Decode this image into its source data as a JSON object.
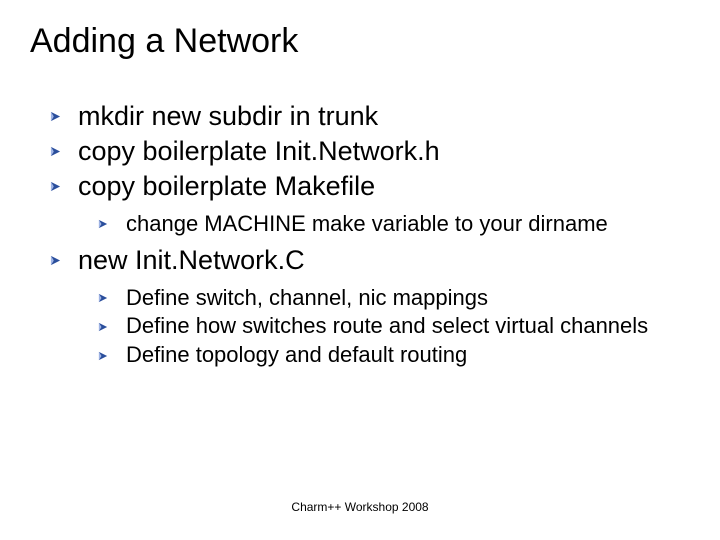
{
  "title": "Adding a Network",
  "bullets": {
    "b1": "mkdir new subdir in trunk",
    "b2": "copy boilerplate Init.Network.h",
    "b3": "copy boilerplate Makefile",
    "b3_1": "change MACHINE make variable to your dirname",
    "b4": "new Init.Network.C",
    "b4_1": "Define switch, channel, nic mappings",
    "b4_2": "Define how switches route and select virtual channels",
    "b4_3": "Define topology and default routing"
  },
  "footer": "Charm++ Workshop 2008",
  "bullet_color": "#2a4e9c",
  "bullet_highlight": "#9fb4e6"
}
